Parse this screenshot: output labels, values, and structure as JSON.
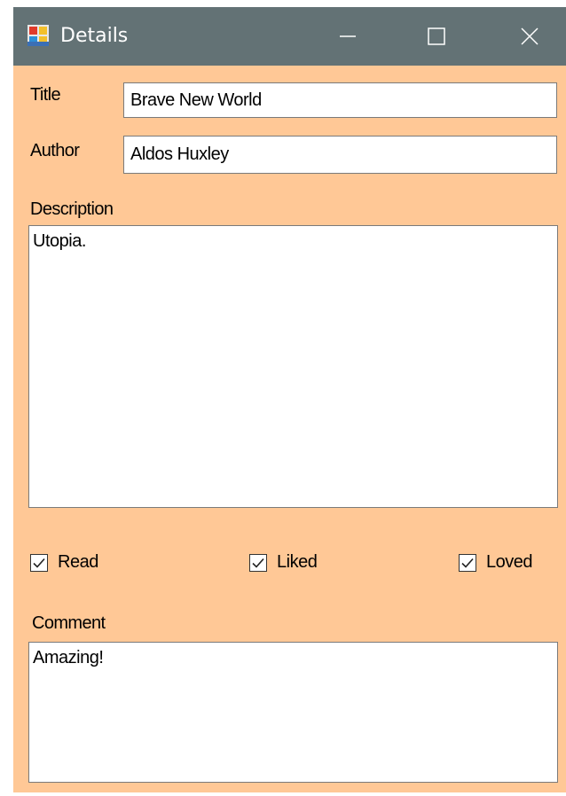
{
  "window": {
    "title": "Details",
    "icon": "windows-forms-app-icon",
    "controls": {
      "minimize": "minimize-icon",
      "maximize": "maximize-icon",
      "close": "close-icon"
    },
    "background_color": "#ffc896",
    "titlebar_color": "#637275"
  },
  "form": {
    "title_label": "Title",
    "title_value": "Brave New World",
    "author_label": "Author",
    "author_value": "Aldos Huxley",
    "description_label": "Description",
    "description_value": "Utopia.",
    "checkboxes": [
      {
        "label": "Read",
        "checked": true
      },
      {
        "label": "Liked",
        "checked": true
      },
      {
        "label": "Loved",
        "checked": true
      }
    ],
    "comment_label": "Comment",
    "comment_value": "Amazing!"
  }
}
